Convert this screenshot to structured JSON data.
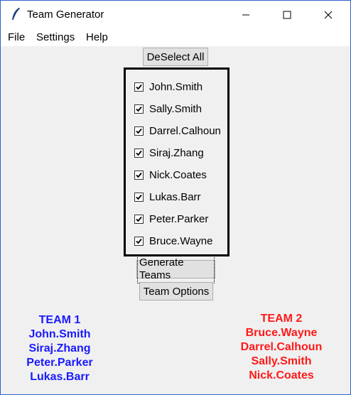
{
  "window": {
    "title": "Team Generator"
  },
  "menubar": {
    "items": [
      "File",
      "Settings",
      "Help"
    ]
  },
  "buttons": {
    "deselect_all": "DeSelect All",
    "generate_teams": "Generate Teams",
    "team_options": "Team Options"
  },
  "players": [
    {
      "name": "John.Smith",
      "checked": true
    },
    {
      "name": "Sally.Smith",
      "checked": true
    },
    {
      "name": "Darrel.Calhoun",
      "checked": true
    },
    {
      "name": "Siraj.Zhang",
      "checked": true
    },
    {
      "name": "Nick.Coates",
      "checked": true
    },
    {
      "name": "Lukas.Barr",
      "checked": true
    },
    {
      "name": "Peter.Parker",
      "checked": true
    },
    {
      "name": "Bruce.Wayne",
      "checked": true
    }
  ],
  "team1": {
    "title": "TEAM 1",
    "color": "#1a1aff",
    "members": [
      "John.Smith",
      "Siraj.Zhang",
      "Peter.Parker",
      "Lukas.Barr"
    ]
  },
  "team2": {
    "title": "TEAM 2",
    "color": "#ff1a1a",
    "members": [
      "Bruce.Wayne",
      "Darrel.Calhoun",
      "Sally.Smith",
      "Nick.Coates"
    ]
  }
}
